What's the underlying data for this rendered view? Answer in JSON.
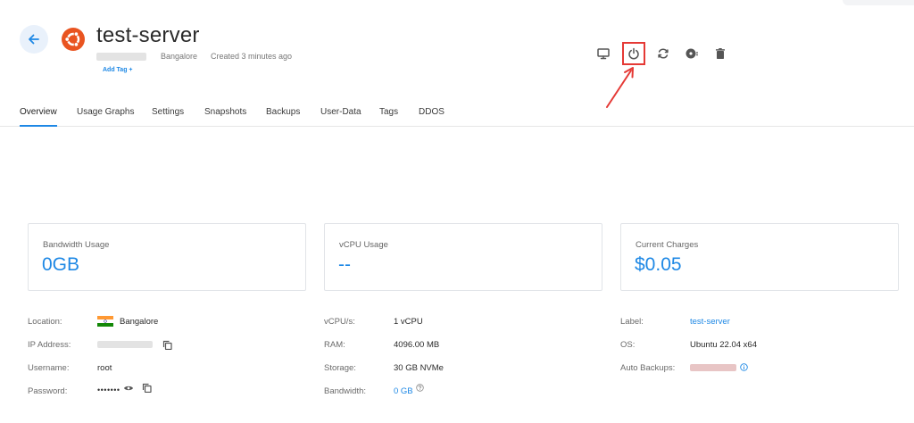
{
  "header": {
    "server_name": "test-server",
    "location": "Bangalore",
    "created": "Created 3 minutes ago",
    "add_tag": "Add Tag +"
  },
  "actions": [
    {
      "name": "console",
      "icon": "monitor-icon"
    },
    {
      "name": "power",
      "icon": "power-icon",
      "highlighted": true
    },
    {
      "name": "restart",
      "icon": "refresh-icon"
    },
    {
      "name": "reinstall",
      "icon": "disc-icon"
    },
    {
      "name": "destroy",
      "icon": "trash-icon"
    }
  ],
  "tabs": [
    {
      "label": "Overview",
      "active": true
    },
    {
      "label": "Usage Graphs"
    },
    {
      "label": "Settings"
    },
    {
      "label": "Snapshots"
    },
    {
      "label": "Backups"
    },
    {
      "label": "User-Data"
    },
    {
      "label": "Tags"
    },
    {
      "label": "DDOS"
    }
  ],
  "cards": {
    "bandwidth": {
      "label": "Bandwidth Usage",
      "value": "0GB"
    },
    "vcpu": {
      "label": "vCPU Usage",
      "value": "--"
    },
    "charges": {
      "label": "Current Charges",
      "value": "$0.05"
    }
  },
  "info": {
    "location_label": "Location:",
    "location_value": "Bangalore",
    "ip_label": "IP Address:",
    "username_label": "Username:",
    "username_value": "root",
    "password_label": "Password:",
    "password_value": "•••••••",
    "vcpus_label": "vCPU/s:",
    "vcpus_value": "1 vCPU",
    "ram_label": "RAM:",
    "ram_value": "4096.00 MB",
    "storage_label": "Storage:",
    "storage_value": "30 GB NVMe",
    "bandwidth_label": "Bandwidth:",
    "bandwidth_value": "0 GB",
    "label_label": "Label:",
    "label_value": "test-server",
    "os_label": "OS:",
    "os_value": "Ubuntu 22.04 x64",
    "autobackups_label": "Auto Backups:"
  },
  "colors": {
    "accent": "#1e88e5",
    "annotation_red": "#e53935",
    "ubuntu_orange": "#e95420"
  }
}
